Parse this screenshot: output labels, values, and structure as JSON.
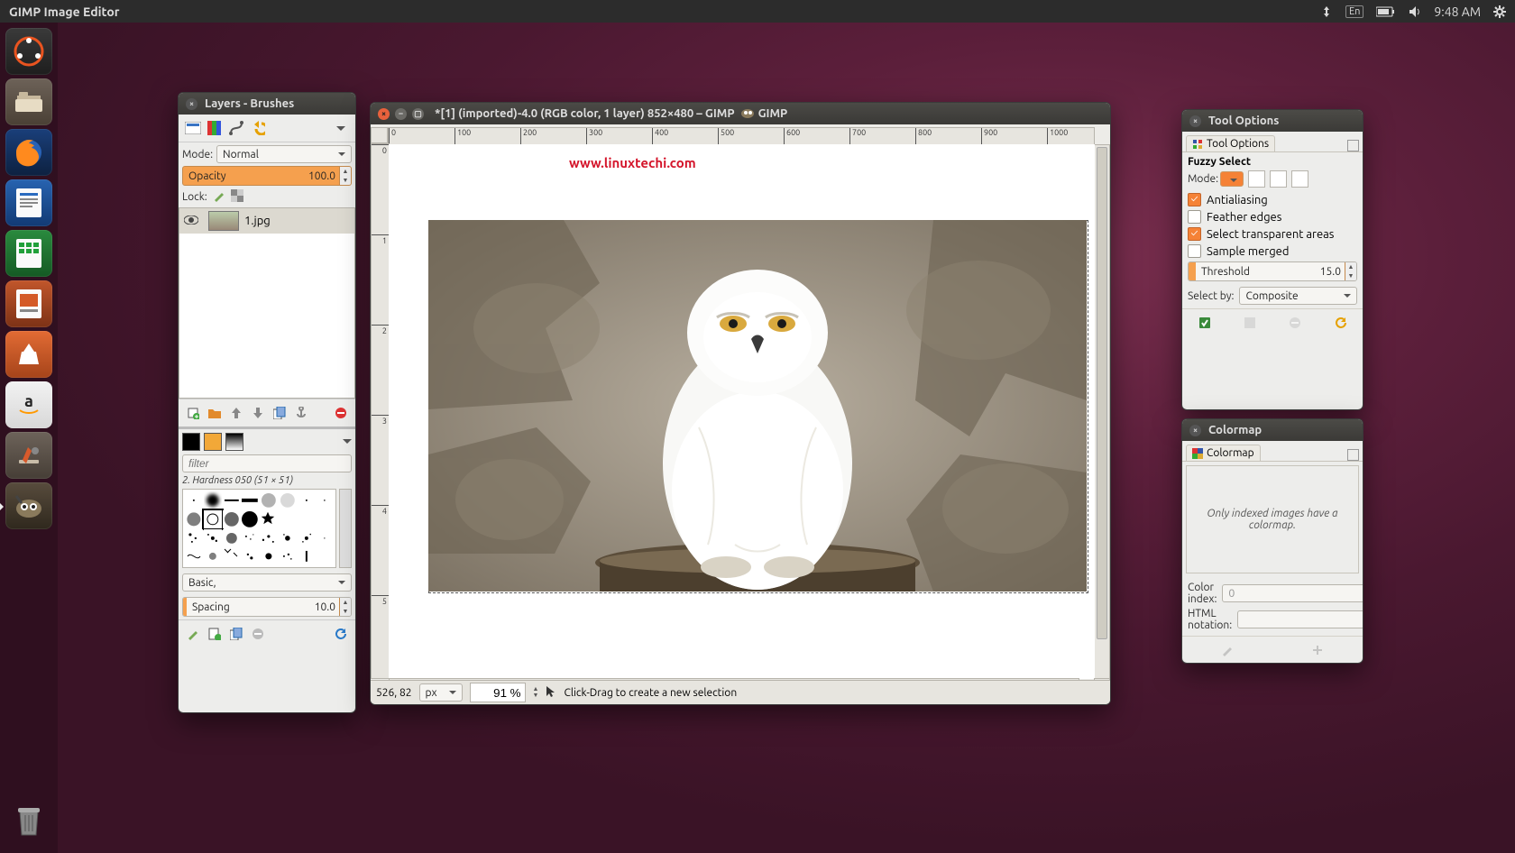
{
  "topbar": {
    "app_title": "GIMP Image Editor",
    "lang": "En",
    "clock": "9:48 AM"
  },
  "launcher": {
    "items": [
      "dash",
      "files",
      "firefox",
      "writer",
      "calc",
      "impress",
      "software",
      "amazon",
      "settings",
      "gimp"
    ]
  },
  "layers_win": {
    "title": "Layers - Brushes",
    "mode_label": "Mode:",
    "mode_value": "Normal",
    "opacity_label": "Opacity",
    "opacity_value": "100.0",
    "lock_label": "Lock:",
    "layer_name": "1.jpg",
    "filter_placeholder": "filter",
    "brush_caption": "2. Hardness 050 (51 × 51)",
    "preset_value": "Basic,",
    "spacing_label": "Spacing",
    "spacing_value": "10.0"
  },
  "main_win": {
    "title": "*[1] (imported)-4.0 (RGB color, 1 layer) 852×480 – GIMP",
    "watermark": "www.linuxtechi.com",
    "ruler_h": [
      "0",
      "100",
      "200",
      "300",
      "400",
      "500",
      "600",
      "700",
      "800",
      "900",
      "1000"
    ],
    "ruler_v": [
      "0",
      "1",
      "2",
      "3",
      "4",
      "5"
    ],
    "cursor_pos": "526, 82",
    "unit": "px",
    "zoom": "91 %",
    "hint": "Click-Drag to create a new selection"
  },
  "tool_win": {
    "title": "Tool Options",
    "tab_label": "Tool Options",
    "tool_name": "Fuzzy Select",
    "mode_label": "Mode:",
    "antialias": "Antialiasing",
    "feather": "Feather edges",
    "transparent": "Select transparent areas",
    "sample_merged": "Sample merged",
    "threshold_label": "Threshold",
    "threshold_value": "15.0",
    "selectby_label": "Select by:",
    "selectby_value": "Composite"
  },
  "color_win": {
    "title": "Colormap",
    "tab_label": "Colormap",
    "empty_msg": "Only indexed images have a colormap.",
    "index_label": "Color index:",
    "index_value": "0",
    "html_label": "HTML notation:"
  }
}
